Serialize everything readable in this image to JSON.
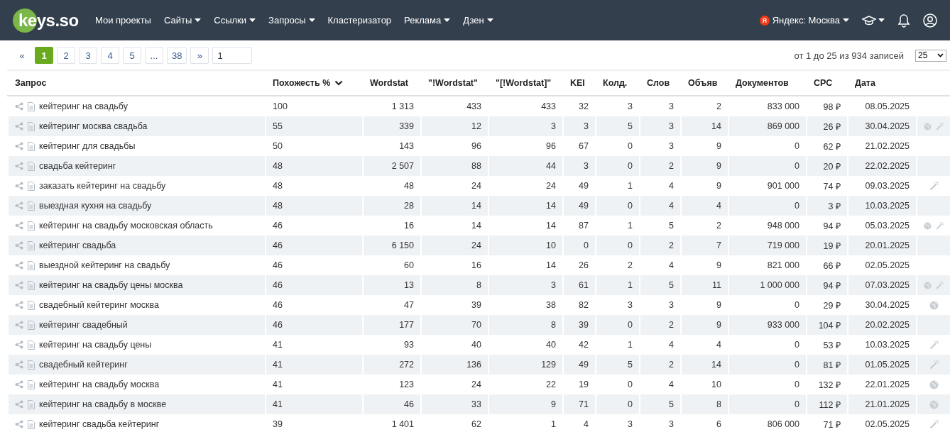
{
  "nav": {
    "logo": "keys.so",
    "items": [
      {
        "label": "Мои проекты",
        "dropdown": false
      },
      {
        "label": "Сайты",
        "dropdown": true
      },
      {
        "label": "Ссылки",
        "dropdown": true
      },
      {
        "label": "Запросы",
        "dropdown": true
      },
      {
        "label": "Кластеризатор",
        "dropdown": false
      },
      {
        "label": "Реклама",
        "dropdown": true
      },
      {
        "label": "Дзен",
        "dropdown": true
      }
    ],
    "region": {
      "badge": "Я",
      "label": "Яндекс: Москва"
    }
  },
  "pagination": {
    "pages": [
      {
        "label": "«",
        "selected": false
      },
      {
        "label": "1",
        "selected": true
      },
      {
        "label": "2",
        "selected": false
      },
      {
        "label": "3",
        "selected": false
      },
      {
        "label": "4",
        "selected": false
      },
      {
        "label": "5",
        "selected": false
      },
      {
        "label": "...",
        "selected": false
      },
      {
        "label": "38",
        "selected": false
      },
      {
        "label": "»",
        "selected": false
      }
    ],
    "jump_value": "1",
    "records_info": "от 1 до 25 из 934 записей",
    "page_size": "25"
  },
  "table": {
    "columns": [
      {
        "label": "Запрос",
        "sorted": false
      },
      {
        "label": "Похожесть %",
        "sorted": true
      },
      {
        "label": "Wordstat",
        "sorted": false
      },
      {
        "label": "\"!Wordstat\"",
        "sorted": false
      },
      {
        "label": "\"[!Wordstat]\"",
        "sorted": false
      },
      {
        "label": "KEI",
        "sorted": false
      },
      {
        "label": "Колд.",
        "sorted": false
      },
      {
        "label": "Слов",
        "sorted": false
      },
      {
        "label": "Объяв",
        "sorted": false
      },
      {
        "label": "Документов",
        "sorted": false
      },
      {
        "label": "CPC",
        "sorted": false
      },
      {
        "label": "Дата",
        "sorted": false
      }
    ],
    "rows": [
      {
        "cells": [
          "кейтеринг на свадьбу",
          "100",
          "1 313",
          "433",
          "433",
          "32",
          "3",
          "3",
          "2",
          "833 000",
          "98 ₽",
          "08.05.2025"
        ],
        "globe": false,
        "wand": false
      },
      {
        "cells": [
          "кейтеринг москва свадьба",
          "55",
          "339",
          "12",
          "3",
          "3",
          "5",
          "3",
          "14",
          "869 000",
          "26 ₽",
          "30.04.2025"
        ],
        "globe": true,
        "wand": true
      },
      {
        "cells": [
          "кейтеринг для свадьбы",
          "50",
          "143",
          "96",
          "96",
          "67",
          "0",
          "3",
          "9",
          "0",
          "62 ₽",
          "21.02.2025"
        ],
        "globe": false,
        "wand": false
      },
      {
        "cells": [
          "свадьба кейтеринг",
          "48",
          "2 507",
          "88",
          "44",
          "3",
          "0",
          "2",
          "9",
          "0",
          "20 ₽",
          "22.02.2025"
        ],
        "globe": false,
        "wand": false
      },
      {
        "cells": [
          "заказать кейтеринг на свадьбу",
          "48",
          "48",
          "24",
          "24",
          "49",
          "1",
          "4",
          "9",
          "901 000",
          "74 ₽",
          "09.03.2025"
        ],
        "globe": false,
        "wand": true
      },
      {
        "cells": [
          "выездная кухня на свадьбу",
          "48",
          "28",
          "14",
          "14",
          "49",
          "0",
          "4",
          "4",
          "0",
          "3 ₽",
          "10.03.2025"
        ],
        "globe": false,
        "wand": false
      },
      {
        "cells": [
          "кейтеринг на свадьбу московская область",
          "46",
          "16",
          "14",
          "14",
          "87",
          "1",
          "5",
          "2",
          "948 000",
          "94 ₽",
          "05.03.2025"
        ],
        "globe": true,
        "wand": true
      },
      {
        "cells": [
          "кейтеринг свадьба",
          "46",
          "6 150",
          "24",
          "10",
          "0",
          "0",
          "2",
          "7",
          "719 000",
          "19 ₽",
          "20.01.2025"
        ],
        "globe": false,
        "wand": false
      },
      {
        "cells": [
          "выездной кейтеринг на свадьбу",
          "46",
          "60",
          "16",
          "14",
          "26",
          "2",
          "4",
          "9",
          "821 000",
          "66 ₽",
          "02.05.2025"
        ],
        "globe": false,
        "wand": false
      },
      {
        "cells": [
          "кейтеринг на свадьбу цены москва",
          "46",
          "13",
          "8",
          "3",
          "61",
          "1",
          "5",
          "11",
          "1 000 000",
          "94 ₽",
          "07.03.2025"
        ],
        "globe": true,
        "wand": true
      },
      {
        "cells": [
          "свадебный кейтеринг москва",
          "46",
          "47",
          "39",
          "38",
          "82",
          "3",
          "3",
          "9",
          "0",
          "29 ₽",
          "30.04.2025"
        ],
        "globe": true,
        "wand": false
      },
      {
        "cells": [
          "кейтеринг свадебный",
          "46",
          "177",
          "70",
          "8",
          "39",
          "0",
          "2",
          "9",
          "933 000",
          "104 ₽",
          "20.02.2025"
        ],
        "globe": false,
        "wand": false
      },
      {
        "cells": [
          "кейтеринг на свадьбу цены",
          "41",
          "93",
          "40",
          "40",
          "42",
          "1",
          "4",
          "4",
          "0",
          "53 ₽",
          "10.03.2025"
        ],
        "globe": false,
        "wand": true
      },
      {
        "cells": [
          "свадебный кейтеринг",
          "41",
          "272",
          "136",
          "129",
          "49",
          "5",
          "2",
          "14",
          "0",
          "81 ₽",
          "01.05.2025"
        ],
        "globe": false,
        "wand": true
      },
      {
        "cells": [
          "кейтеринг на свадьбу москва",
          "41",
          "123",
          "24",
          "22",
          "19",
          "0",
          "4",
          "10",
          "0",
          "132 ₽",
          "22.01.2025"
        ],
        "globe": true,
        "wand": false
      },
      {
        "cells": [
          "кейтеринг на свадьбу в москве",
          "41",
          "46",
          "33",
          "9",
          "71",
          "0",
          "5",
          "8",
          "0",
          "112 ₽",
          "21.01.2025"
        ],
        "globe": true,
        "wand": false
      },
      {
        "cells": [
          "кейтеринг свадьба кейтеринг",
          "39",
          "1 401",
          "62",
          "1",
          "4",
          "3",
          "3",
          "6",
          "806 000",
          "71 ₽",
          "02.05.2025"
        ],
        "globe": false,
        "wand": true
      }
    ]
  }
}
